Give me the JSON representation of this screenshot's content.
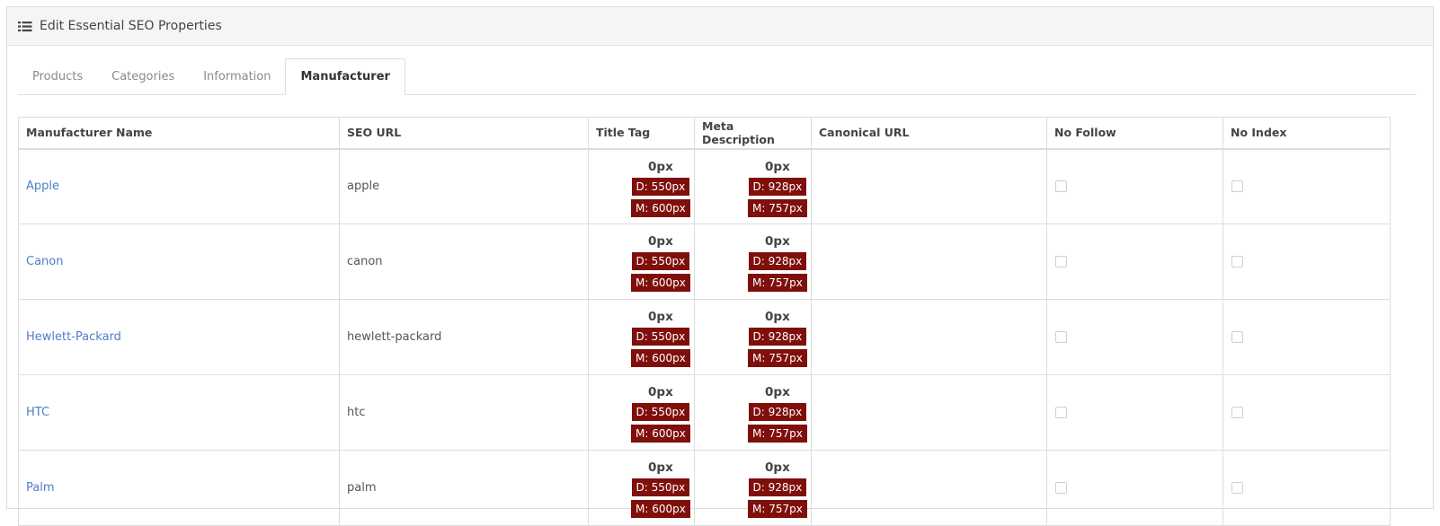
{
  "panel": {
    "title": "Edit Essential SEO Properties",
    "icon": "list-icon"
  },
  "tabs": [
    {
      "label": "Products",
      "active": false
    },
    {
      "label": "Categories",
      "active": false
    },
    {
      "label": "Information",
      "active": false
    },
    {
      "label": "Manufacturer",
      "active": true
    }
  ],
  "table": {
    "headers": [
      "Manufacturer Name",
      "SEO URL",
      "Title Tag",
      "Meta Description",
      "Canonical URL",
      "No Follow",
      "No Index"
    ],
    "rows": [
      {
        "name": "Apple",
        "seo_url": "apple",
        "title": {
          "value": "0px",
          "desktop": "D: 550px",
          "mobile": "M: 600px"
        },
        "meta": {
          "value": "0px",
          "desktop": "D: 928px",
          "mobile": "M: 757px"
        },
        "canonical": "",
        "no_follow": false,
        "no_index": false
      },
      {
        "name": "Canon",
        "seo_url": "canon",
        "title": {
          "value": "0px",
          "desktop": "D: 550px",
          "mobile": "M: 600px"
        },
        "meta": {
          "value": "0px",
          "desktop": "D: 928px",
          "mobile": "M: 757px"
        },
        "canonical": "",
        "no_follow": false,
        "no_index": false
      },
      {
        "name": "Hewlett-Packard",
        "seo_url": "hewlett-packard",
        "title": {
          "value": "0px",
          "desktop": "D: 550px",
          "mobile": "M: 600px"
        },
        "meta": {
          "value": "0px",
          "desktop": "D: 928px",
          "mobile": "M: 757px"
        },
        "canonical": "",
        "no_follow": false,
        "no_index": false
      },
      {
        "name": "HTC",
        "seo_url": "htc",
        "title": {
          "value": "0px",
          "desktop": "D: 550px",
          "mobile": "M: 600px"
        },
        "meta": {
          "value": "0px",
          "desktop": "D: 928px",
          "mobile": "M: 757px"
        },
        "canonical": "",
        "no_follow": false,
        "no_index": false
      },
      {
        "name": "Palm",
        "seo_url": "palm",
        "title": {
          "value": "0px",
          "desktop": "D: 550px",
          "mobile": "M: 600px"
        },
        "meta": {
          "value": "0px",
          "desktop": "D: 928px",
          "mobile": "M: 757px"
        },
        "canonical": "",
        "no_follow": false,
        "no_index": false
      }
    ]
  },
  "colors": {
    "badge": "#7f0f0b",
    "link": "#4e7ec8"
  }
}
